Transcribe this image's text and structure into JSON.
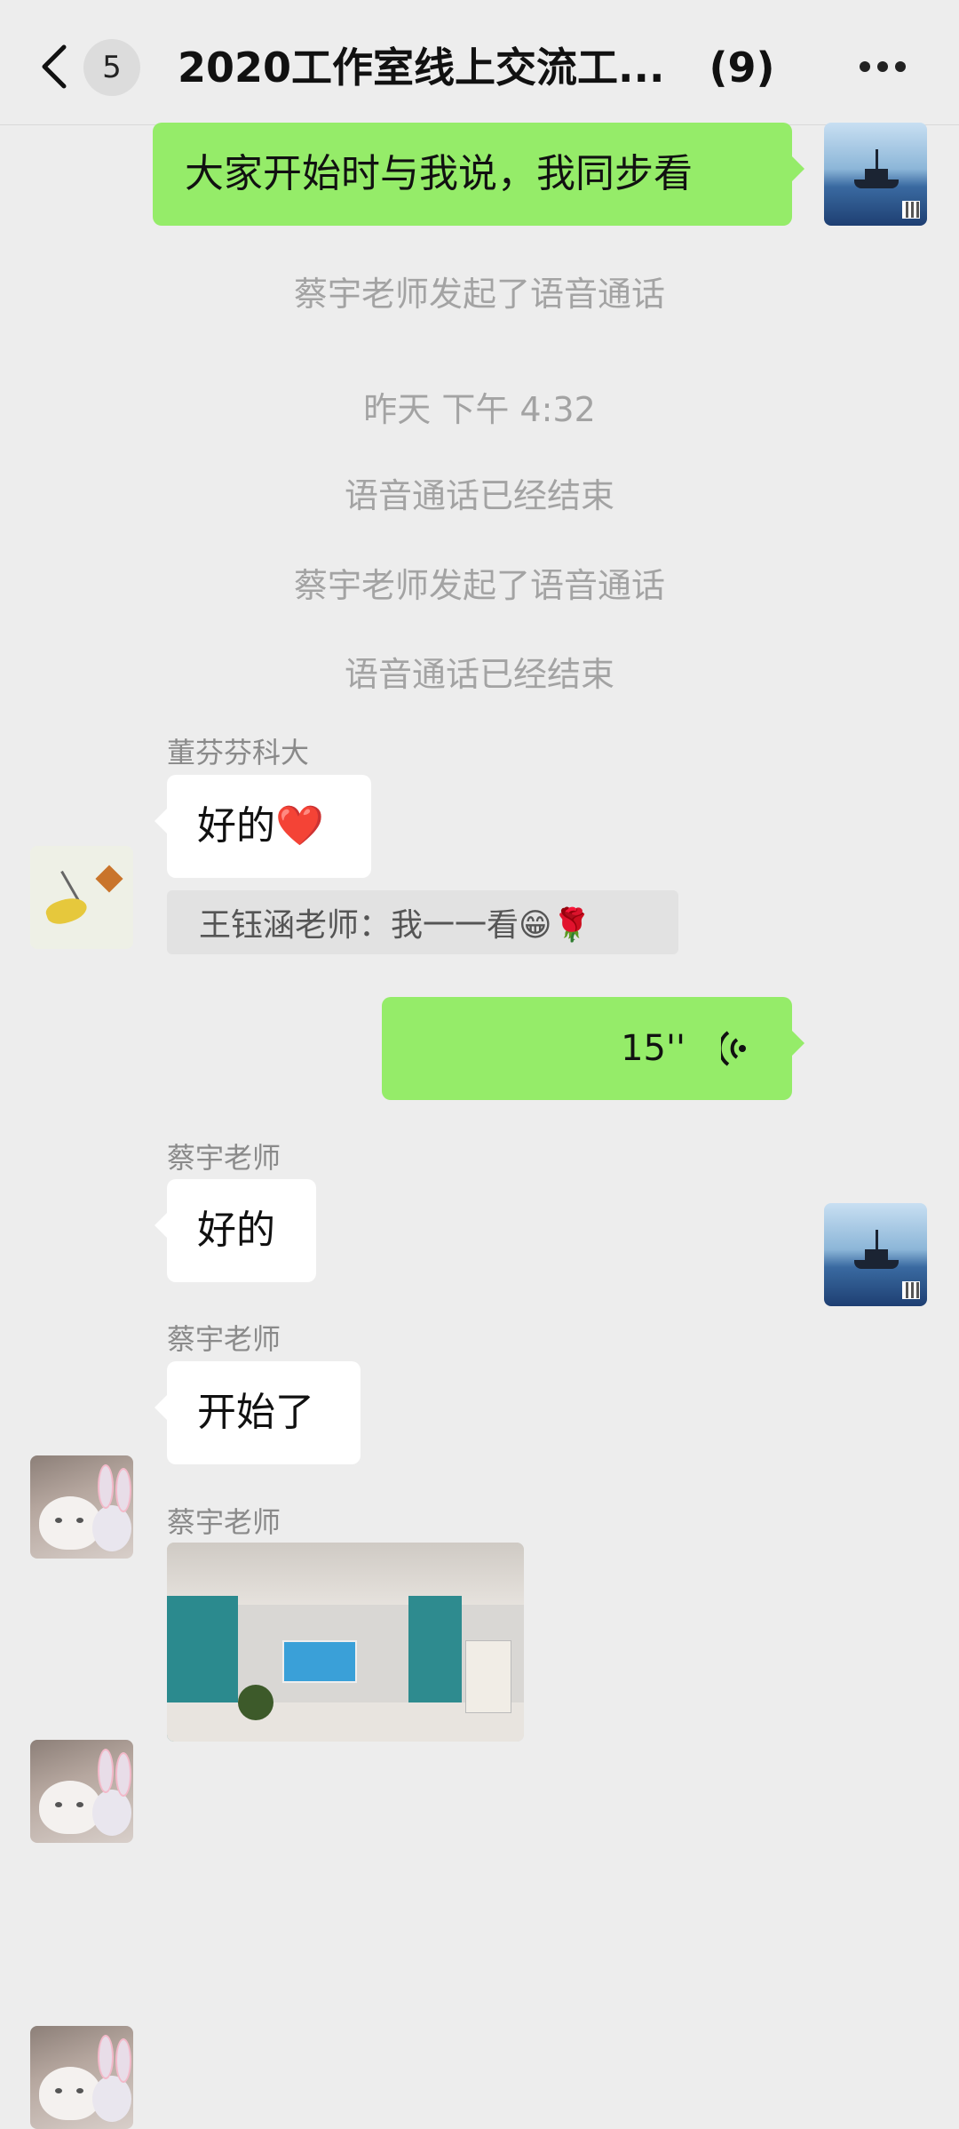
{
  "header": {
    "unread_count": "5",
    "title": "2020工作室线上交流工...",
    "member_count": "(9)"
  },
  "messages": {
    "m1_text": "大家开始时与我说，我同步看",
    "sys1": "蔡宇老师发起了语音通话",
    "time1": "昨天 下午 4:32",
    "sys2": "语音通话已经结束",
    "sys3": "蔡宇老师发起了语音通话",
    "sys4": "语音通话已经结束",
    "m2_sender": "董芬芬科大",
    "m2_text": "好的❤️",
    "m2_quote": "王钰涵老师：我一一看😁🌹",
    "m3_voice_duration": "15''",
    "m4_sender": "蔡宇老师",
    "m4_text": "好的",
    "m5_sender": "蔡宇老师",
    "m5_text": "开始了",
    "m6_sender": "蔡宇老师"
  },
  "icons": [
    "back-chevron-icon",
    "more-dots-icon",
    "voice-wave-icon"
  ],
  "colors": {
    "my_bubble": "#95ec69",
    "their_bubble": "#ffffff",
    "background": "#ededed"
  }
}
